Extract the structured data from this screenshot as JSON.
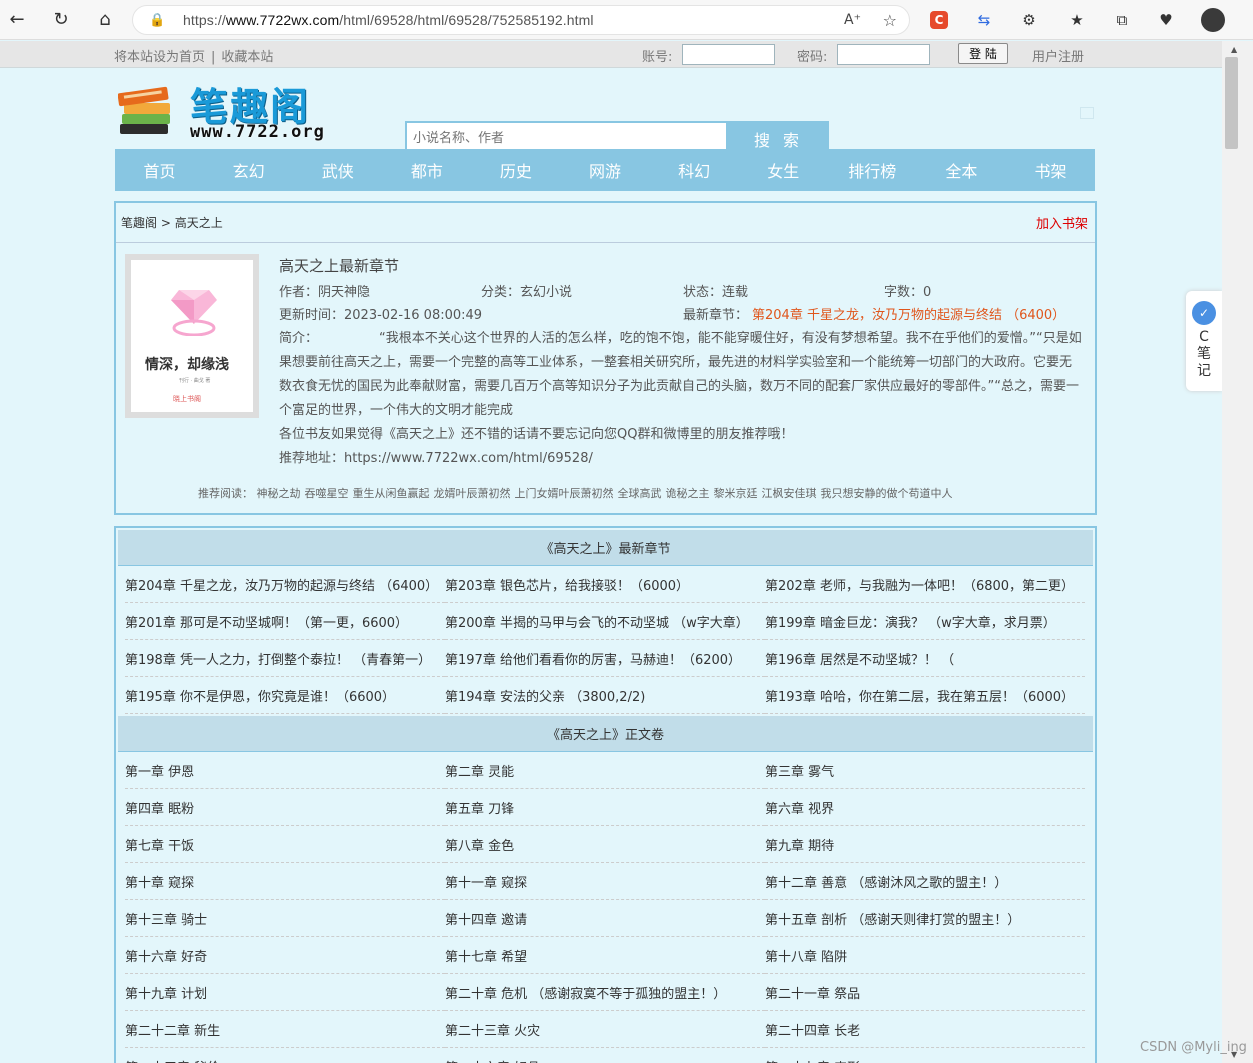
{
  "browser": {
    "url_prefix": "https://",
    "url_host": "www.7722wx.com",
    "url_path": "/html/69528/html/69528/752585192.html",
    "icons": [
      "back-icon",
      "reload-icon",
      "home-icon",
      "lock-icon",
      "read-aloud-icon",
      "favorite-add-icon",
      "extension-c-icon",
      "sync-icon",
      "puzzle-icon",
      "favorites-icon",
      "collections-icon",
      "health-icon",
      "avatar"
    ]
  },
  "topbar": {
    "set_home": "将本站设为首页",
    "separator": "|",
    "bookmark": "收藏本站",
    "account_label": "账号:",
    "password_label": "密码:",
    "login": "登 陆",
    "register": "用户注册"
  },
  "header": {
    "logo_title": "笔趣阁",
    "logo_domain": "www.7722.org",
    "search_placeholder": "小说名称、作者",
    "search_button": "搜 索"
  },
  "nav": [
    "首页",
    "玄幻",
    "武侠",
    "都市",
    "历史",
    "网游",
    "科幻",
    "女生",
    "排行榜",
    "全本",
    "书架"
  ],
  "breadcrumb": {
    "home": "笔趣阁",
    "sep": " > ",
    "current": "高天之上",
    "add_shelf": "加入书架"
  },
  "cover": {
    "title": "情深，却缘浅",
    "author": "刊行 · 曲戈 著",
    "publisher": "晓上书阁"
  },
  "book": {
    "heading": "高天之上最新章节",
    "author": "作者：阴天神隐",
    "category": "分类：玄幻小说",
    "status": "状态：连载",
    "words": "字数：0",
    "update_time": "更新时间：2023-02-16 08:00:49",
    "latest_label": "最新章节：",
    "latest_chapter": "第204章 千星之龙，汝乃万物的起源与终结 （6400）",
    "intro_label": "简介：",
    "intro": "“我根本不关心这个世界的人活的怎么样，吃的饱不饱，能不能穿暖住好，有没有梦想希望。我不在乎他们的爱憎。”“只是如果想要前往高天之上，需要一个完整的高等工业体系，一整套相关研究所，最先进的材料学实验室和一个能统筹一切部门的大政府。它要无数衣食无忧的国民为此奉献财富，需要几百万个高等知识分子为此贡献自己的头脑，数万不同的配套厂家供应最好的零部件。”“总之，需要一个富足的世界，一个伟大的文明才能完成",
    "share": "各位书友如果觉得《高天之上》还不错的话请不要忘记向您QQ群和微博里的朋友推荐哦！",
    "rec_url": "推荐地址：https://www.7722wx.com/html/69528/"
  },
  "recommend": {
    "label": "推荐阅读：",
    "items": [
      "神秘之劫",
      "吞噬星空",
      "重生从闲鱼赢起",
      "龙婿叶辰萧初然",
      "上门女婿叶辰萧初然",
      "全球高武",
      "诡秘之主",
      "黎米京廷",
      "江枫安佳琪",
      "我只想安静的做个苟道中人"
    ]
  },
  "latest_section": {
    "title": "《高天之上》最新章节",
    "chapters": [
      "第204章 千星之龙，汝乃万物的起源与终结 （6400）",
      "第203章 银色芯片，给我接驳！（6000）",
      "第202章 老师，与我融为一体吧！（6800，第二更）",
      "第201章 那可是不动坚城啊！（第一更，6600）",
      "第200章 半揭的马甲与会飞的不动坚城 （w字大章）",
      "第199章 暗金巨龙：演我？ （w字大章，求月票）",
      "第198章 凭一人之力，打倒整个泰拉！ （青春第一）",
      "第197章 给他们看看你的厉害，马赫迪！（6200）",
      "第196章 居然是不动坚城？！ （",
      "第195章 你不是伊恩，你究竟是谁！（6600）",
      "第194章 安法的父亲 （3800,2/2)",
      "第193章 哈哈，你在第二层，我在第五层！（6000）"
    ]
  },
  "main_section": {
    "title": "《高天之上》正文卷",
    "chapters": [
      "第一章 伊恩",
      "第二章 灵能",
      "第三章 雾气",
      "第四章 眠粉",
      "第五章 刀锋",
      "第六章 视界",
      "第七章 干饭",
      "第八章 金色",
      "第九章 期待",
      "第十章 窥探",
      "第十一章 窥探",
      "第十二章 善意 （感谢沐风之歌的盟主！）",
      "第十三章 骑士",
      "第十四章 邀请",
      "第十五章 剖析 （感谢天则律打赏的盟主！）",
      "第十六章 好奇",
      "第十七章 希望",
      "第十八章 陷阱",
      "第十九章 计划",
      "第二十章 危机 （感谢寂寞不等于孤独的盟主！）",
      "第二十一章 祭品",
      "第二十二章 新生",
      "第二十三章 火灾",
      "第二十四章 长老",
      "第二十五章 秘伦",
      "第二十六章 好品",
      "第二十七章 丧形"
    ]
  },
  "side_tool": {
    "label": "C笔记"
  },
  "watermark": "CSDN @Myli_ing"
}
